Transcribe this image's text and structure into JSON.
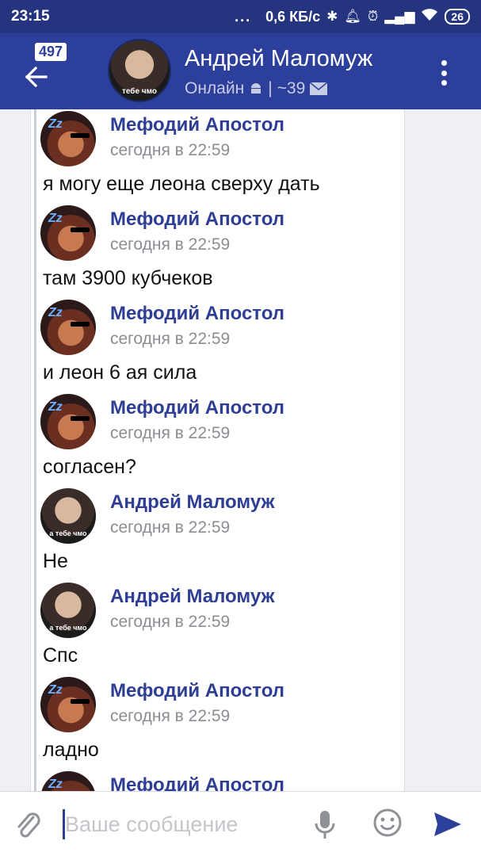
{
  "status_bar": {
    "time": "23:15",
    "dots": "...",
    "speed": "0,6 КБ/с",
    "battery": "26"
  },
  "header": {
    "badge": "497",
    "name": "Андрей Маломуж",
    "status": "Онлайн",
    "divider": "|",
    "count": "~39",
    "avatar_caption": "тебе чмо"
  },
  "messages": [
    {
      "author": "Мефодий Апостол",
      "time": "сегодня в 22:59",
      "text": "я могу еще леона сверху дать",
      "avatar": "mefodiy"
    },
    {
      "author": "Мефодий Апостол",
      "time": "сегодня в 22:59",
      "text": "там 3900 кубчеков",
      "avatar": "mefodiy"
    },
    {
      "author": "Мефодий Апостол",
      "time": "сегодня в 22:59",
      "text": "и леон 6 ая сила",
      "avatar": "mefodiy"
    },
    {
      "author": "Мефодий Апостол",
      "time": "сегодня в 22:59",
      "text": "согласен?",
      "avatar": "mefodiy"
    },
    {
      "author": "Андрей Маломуж",
      "time": "сегодня в 22:59",
      "text": "Не",
      "avatar": "andrey"
    },
    {
      "author": "Андрей Маломуж",
      "time": "сегодня в 22:59",
      "text": "Спс",
      "avatar": "andrey"
    },
    {
      "author": "Мефодий Апостол",
      "time": "сегодня в 22:59",
      "text": "ладно",
      "avatar": "mefodiy"
    },
    {
      "author": "Мефодий Апостол",
      "time": "",
      "text": "",
      "avatar": "mefodiy"
    }
  ],
  "avatar_caption_andrey": "а тебе чмо",
  "composer": {
    "placeholder": "Ваше сообщение"
  },
  "colors": {
    "status_bar": "#24347f",
    "app_bar": "#2c3f9a",
    "author": "#2d3e94",
    "send": "#2c3f9a"
  }
}
